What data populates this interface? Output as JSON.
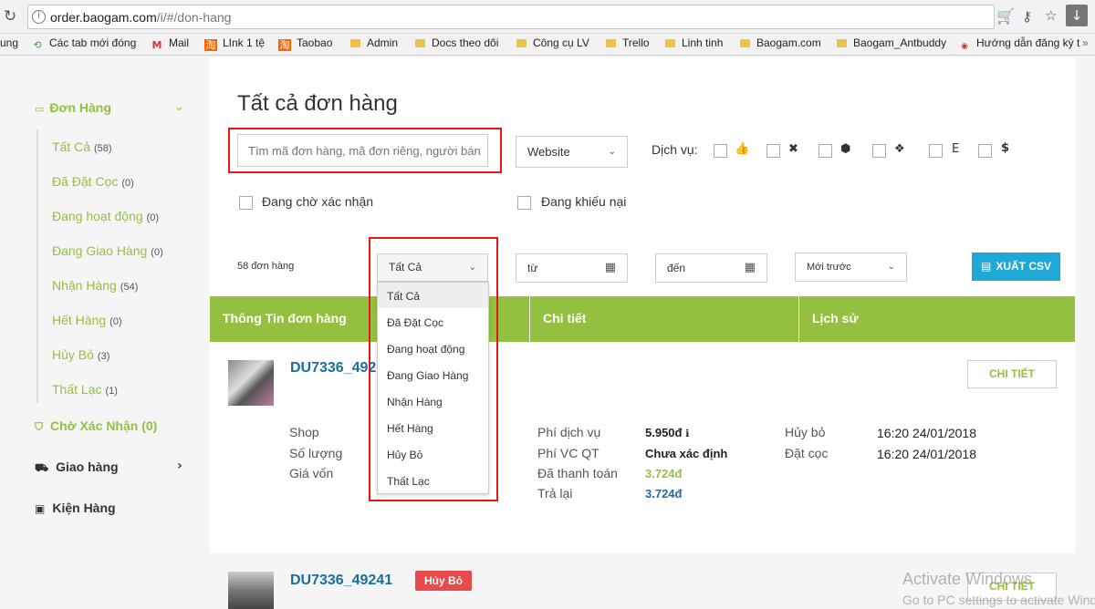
{
  "browser": {
    "url_host": "order.baogam.com",
    "url_path": "/i/#/don-hang",
    "bookmarks": [
      "ung",
      "Các tab mới đóng",
      "Mail",
      "LInk 1 tệ",
      "Taobao",
      "Admin",
      "Docs theo dõi",
      "Công cụ LV",
      "Trello",
      "Linh tinh",
      "Baogam.com",
      "Baogam_Antbuddy",
      "Hướng dẫn đăng ký t"
    ]
  },
  "sidebar": {
    "don_hang": "Đơn Hàng",
    "items": [
      {
        "label": "Tất Cả",
        "count": "(58)"
      },
      {
        "label": "Đã Đặt Cọc",
        "count": "(0)"
      },
      {
        "label": "Đang hoạt động",
        "count": "(0)"
      },
      {
        "label": "Đang Giao Hàng",
        "count": "(0)"
      },
      {
        "label": "Nhận Hàng",
        "count": "(54)"
      },
      {
        "label": "Hết Hàng",
        "count": "(0)"
      },
      {
        "label": "Hủy Bỏ",
        "count": "(3)"
      },
      {
        "label": "Thất Lạc",
        "count": "(1)"
      }
    ],
    "cho_xac_nhan": "Chờ Xác Nhận (0)",
    "giao_hang": "Giao hàng",
    "kien_hang": "Kiện Hàng"
  },
  "main": {
    "title": "Tất cả đơn hàng",
    "search_placeholder": "Tìm mã đơn hàng, mã đơn riêng, người bán",
    "website_select": "Website",
    "dich_vu_label": "Dịch vụ:",
    "svc_e": "E",
    "svc_dollar": "$",
    "cho_xac_nhan": "Đang chờ xác nhận",
    "khieu_nai": "Đang khiếu nại",
    "order_count": "58 đơn hàng",
    "status_select": "Tất Cả",
    "from_placeholder": "từ",
    "to_placeholder": "đến",
    "sort_select": "Mới trước",
    "csv_button": "XUẤT CSV",
    "table_headers": [
      "Thông Tin đơn hàng",
      "Chi tiết",
      "Lịch sử"
    ],
    "status_options": [
      "Tất Cả",
      "Đã Đặt Cọc",
      "Đang hoạt động",
      "Đang Giao Hàng",
      "Nhận Hàng",
      "Hết Hàng",
      "Hủy Bỏ",
      "Thất Lạc"
    ]
  },
  "order1": {
    "id": "DU7336_492",
    "detail_button": "CHI TIẾT",
    "labels": [
      "Shop",
      "Số lượng",
      "Giá vốn"
    ],
    "fee_labels": [
      "Phí dịch vụ",
      "Phí VC QT",
      "Đã thanh toán",
      "Trả lại"
    ],
    "fee_values": [
      "5.950đ",
      "Chưa xác định",
      "3.724đ",
      "3.724đ"
    ],
    "history": [
      {
        "label": "Hủy bỏ",
        "time": "16:20 24/01/2018"
      },
      {
        "label": "Đặt cọc",
        "time": "16:20 24/01/2018"
      }
    ]
  },
  "order2": {
    "id": "DU7336_49241",
    "status_badge": "Hủy Bỏ",
    "detail_button": "CHI TIẾT"
  },
  "watermark": {
    "line1": "Activate Windows",
    "line2": "Go to PC settings to activate Windows."
  },
  "colors": {
    "accent_green": "#93c13f",
    "link_blue": "#1a6ea0",
    "csv_blue": "#1fa8d6",
    "highlight_red": "#e01818"
  }
}
